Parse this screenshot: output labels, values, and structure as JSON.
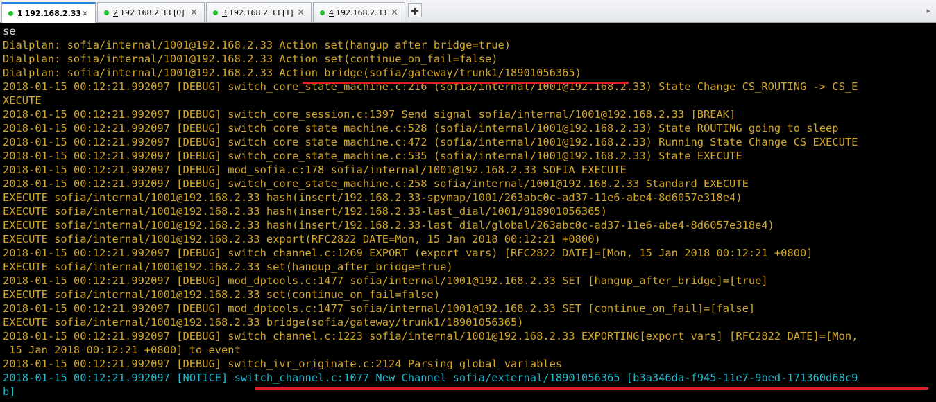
{
  "tabs": [
    {
      "num": "1",
      "label": " 192.168.2.33",
      "close": "×",
      "active": true
    },
    {
      "num": "2",
      "label": " 192.168.2.33 [0]",
      "close": "×",
      "active": false
    },
    {
      "num": "3",
      "label": " 192.168.2.33 [1]",
      "close": "×",
      "active": false
    },
    {
      "num": "4",
      "label": " 192.168.2.33",
      "close": "×",
      "active": false
    }
  ],
  "new_tab_label": "+",
  "scroll_right_icon": "▸",
  "terminal": {
    "lines": [
      "se",
      "Dialplan: sofia/internal/1001@192.168.2.33 Action set(hangup_after_bridge=true)",
      "Dialplan: sofia/internal/1001@192.168.2.33 Action set(continue_on_fail=false)",
      "Dialplan: sofia/internal/1001@192.168.2.33 Action bridge(sofia/gateway/trunk1/18901056365)",
      "2018-01-15 00:12:21.992097 [DEBUG] switch_core_state_machine.c:216 (sofia/internal/1001@192.168.2.33) State Change CS_ROUTING -> CS_E",
      "XECUTE",
      "2018-01-15 00:12:21.992097 [DEBUG] switch_core_session.c:1397 Send signal sofia/internal/1001@192.168.2.33 [BREAK]",
      "2018-01-15 00:12:21.992097 [DEBUG] switch_core_state_machine.c:528 (sofia/internal/1001@192.168.2.33) State ROUTING going to sleep",
      "2018-01-15 00:12:21.992097 [DEBUG] switch_core_state_machine.c:472 (sofia/internal/1001@192.168.2.33) Running State Change CS_EXECUTE",
      "2018-01-15 00:12:21.992097 [DEBUG] switch_core_state_machine.c:535 (sofia/internal/1001@192.168.2.33) State EXECUTE",
      "2018-01-15 00:12:21.992097 [DEBUG] mod_sofia.c:178 sofia/internal/1001@192.168.2.33 SOFIA EXECUTE",
      "2018-01-15 00:12:21.992097 [DEBUG] switch_core_state_machine.c:258 sofia/internal/1001@192.168.2.33 Standard EXECUTE",
      "EXECUTE sofia/internal/1001@192.168.2.33 hash(insert/192.168.2.33-spymap/1001/263abc0c-ad37-11e6-abe4-8d6057e318e4)",
      "EXECUTE sofia/internal/1001@192.168.2.33 hash(insert/192.168.2.33-last_dial/1001/918901056365)",
      "EXECUTE sofia/internal/1001@192.168.2.33 hash(insert/192.168.2.33-last_dial/global/263abc0c-ad37-11e6-abe4-8d6057e318e4)",
      "EXECUTE sofia/internal/1001@192.168.2.33 export(RFC2822_DATE=Mon, 15 Jan 2018 00:12:21 +0800)",
      "2018-01-15 00:12:21.992097 [DEBUG] switch_channel.c:1269 EXPORT (export_vars) [RFC2822_DATE]=[Mon, 15 Jan 2018 00:12:21 +0800]",
      "EXECUTE sofia/internal/1001@192.168.2.33 set(hangup_after_bridge=true)",
      "2018-01-15 00:12:21.992097 [DEBUG] mod_dptools.c:1477 sofia/internal/1001@192.168.2.33 SET [hangup_after_bridge]=[true]",
      "EXECUTE sofia/internal/1001@192.168.2.33 set(continue_on_fail=false)",
      "2018-01-15 00:12:21.992097 [DEBUG] mod_dptools.c:1477 sofia/internal/1001@192.168.2.33 SET [continue_on_fail]=[false]",
      "EXECUTE sofia/internal/1001@192.168.2.33 bridge(sofia/gateway/trunk1/18901056365)",
      "2018-01-15 00:12:21.992097 [DEBUG] switch_channel.c:1223 sofia/internal/1001@192.168.2.33 EXPORTING[export_vars] [RFC2822_DATE]=[Mon,",
      " 15 Jan 2018 00:12:21 +0800] to event",
      "2018-01-15 00:12:21.992097 [DEBUG] switch_ivr_originate.c:2124 Parsing global variables",
      "2018-01-15 00:12:21.992097 [NOTICE] switch_channel.c:1077 New Channel sofia/external/18901056365 [b3a346da-f945-11e7-9bed-171360d68c9",
      "b]"
    ]
  },
  "colors": {
    "log_text": "#d3a72a",
    "notice_text": "#24b7c9",
    "prompt_text": "#d9d9d9",
    "annotation_underline": "#e01e26",
    "active_tab_accent": "#2b7fd6",
    "connected_dot": "#1fbf2a"
  }
}
